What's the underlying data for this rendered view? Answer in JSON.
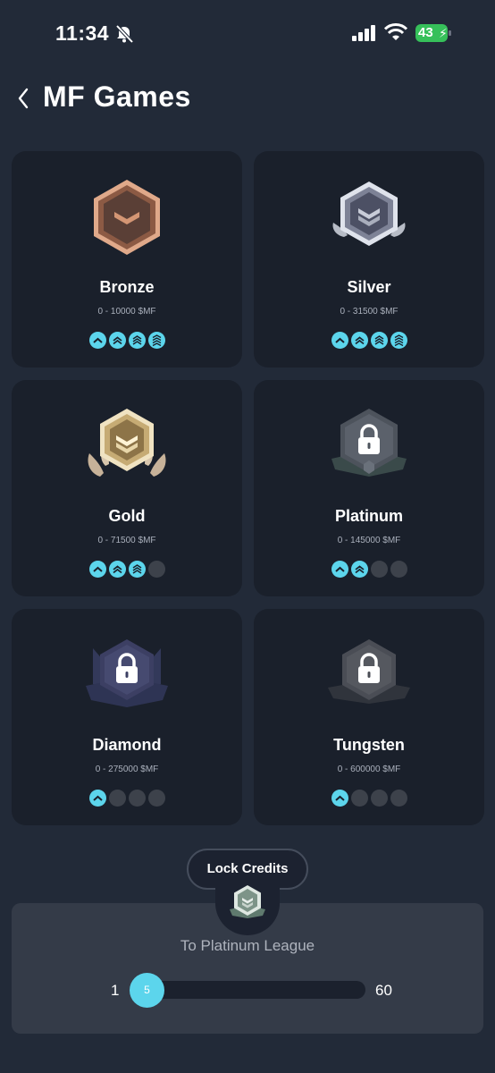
{
  "status_bar": {
    "time": "11:34",
    "battery": "43",
    "icons": [
      "bell-slash-icon",
      "signal-icon",
      "wifi-icon",
      "battery-charging-icon"
    ]
  },
  "header": {
    "title": "MF Games",
    "back_icon": "chevron-left-icon"
  },
  "leagues": [
    {
      "name": "Bronze",
      "range": "0 - 10000 $MF",
      "unlocked_tiers": 4,
      "total_tiers": 4,
      "locked": false,
      "accent": "#c58a6a"
    },
    {
      "name": "Silver",
      "range": "0 - 31500 $MF",
      "unlocked_tiers": 4,
      "total_tiers": 4,
      "locked": false,
      "accent": "#b9bfcf"
    },
    {
      "name": "Gold",
      "range": "0 - 71500 $MF",
      "unlocked_tiers": 3,
      "total_tiers": 4,
      "locked": false,
      "accent": "#d6c18e"
    },
    {
      "name": "Platinum",
      "range": "0 - 145000 $MF",
      "unlocked_tiers": 2,
      "total_tiers": 4,
      "locked": true,
      "accent": "#4d535c"
    },
    {
      "name": "Diamond",
      "range": "0 - 275000 $MF",
      "unlocked_tiers": 1,
      "total_tiers": 4,
      "locked": true,
      "accent": "#3c3f63"
    },
    {
      "name": "Tungsten",
      "range": "0 - 600000 $MF",
      "unlocked_tiers": 1,
      "total_tiers": 4,
      "locked": true,
      "accent": "#4a4d55"
    }
  ],
  "lock_credits": {
    "button_label": "Lock Credits",
    "target_label": "To Platinum League",
    "min": "1",
    "max": "60",
    "value": "5"
  },
  "colors": {
    "background": "#222a38",
    "card": "#1a202b",
    "accent": "#5cd5ec",
    "tier_off": "#3d424b"
  }
}
